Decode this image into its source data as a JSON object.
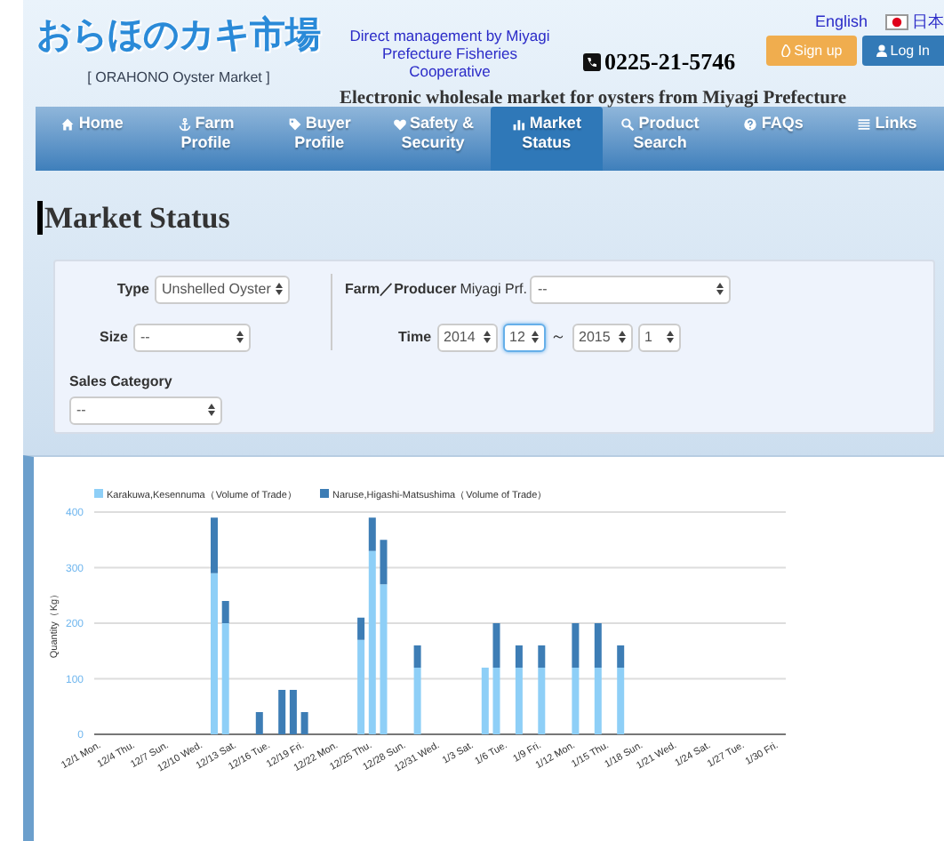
{
  "header": {
    "logo": "おらほのカキ市場",
    "logo_subtitle": "[ ORAHONO Oyster Market ]",
    "management": "Direct management by Miyagi Prefecture Fisheries Cooperative",
    "phone": "0225-21-5746",
    "tagline": "Electronic wholesale market for oysters from Miyagi Prefecture",
    "languages": [
      "English",
      "日本"
    ],
    "buttons": [
      {
        "label": "Sign up",
        "kind": "signup"
      },
      {
        "label": "Log In",
        "kind": "login"
      }
    ]
  },
  "nav": [
    {
      "label": "Home",
      "selected": false
    },
    {
      "label": "Farm Profile",
      "selected": false
    },
    {
      "label": "Buyer Profile",
      "selected": false
    },
    {
      "label": "Safety & Security",
      "selected": false
    },
    {
      "label": "Market Status",
      "selected": true
    },
    {
      "label": "Product Search",
      "selected": false
    },
    {
      "label": "FAQs",
      "selected": false
    },
    {
      "label": "Links",
      "selected": false
    }
  ],
  "page_title": "Market Status",
  "filters": {
    "type": {
      "label": "Type",
      "value": "Unshelled Oyster"
    },
    "size": {
      "label": "Size",
      "value": "--"
    },
    "sales_category": {
      "label": "Sales Category",
      "value": "--"
    },
    "farm": {
      "label": "Farm／Producer",
      "prefix": "Miyagi Prf.",
      "value": "--"
    },
    "time": {
      "label": "Time",
      "separator": "～",
      "selects": [
        {
          "value": "2014",
          "focused": false
        },
        {
          "value": "12",
          "focused": true
        },
        {
          "value": "2015",
          "focused": false
        },
        {
          "value": "1",
          "focused": false
        }
      ]
    }
  },
  "chart_data": {
    "type": "bar",
    "stacked": true,
    "ylabel": "Quantity（Kg）",
    "categories": [
      "12/1 Mon.",
      null,
      null,
      "12/4 Thu.",
      null,
      null,
      "12/7 Sun.",
      null,
      null,
      "12/10 Wed.",
      null,
      null,
      "12/13 Sat.",
      null,
      null,
      "12/16 Tue.",
      null,
      null,
      "12/19 Fri.",
      null,
      null,
      "12/22 Mon.",
      null,
      null,
      "12/25 Thu.",
      null,
      null,
      "12/28 Sun.",
      null,
      null,
      "12/31 Wed.",
      null,
      null,
      "1/3 Sat.",
      null,
      null,
      "1/6 Tue.",
      null,
      null,
      "1/9 Fri.",
      null,
      null,
      "1/12 Mon.",
      null,
      null,
      "1/15 Thu.",
      null,
      null,
      "1/18 Sun.",
      null,
      null,
      "1/21 Wed.",
      null,
      null,
      "1/24 Sat.",
      null,
      null,
      "1/27 Tue.",
      null,
      null,
      "1/30 Fri."
    ],
    "series": [
      {
        "name": "Karakuwa,Kesennuma（Volume of Trade）",
        "color": "#8ecff7",
        "values": [
          null,
          null,
          null,
          null,
          null,
          null,
          null,
          null,
          null,
          null,
          290,
          200,
          null,
          null,
          null,
          null,
          null,
          null,
          null,
          null,
          null,
          null,
          null,
          170,
          330,
          270,
          null,
          null,
          120,
          null,
          null,
          null,
          null,
          null,
          120,
          120,
          null,
          120,
          null,
          120,
          null,
          null,
          120,
          null,
          120,
          null,
          120,
          null,
          null,
          null,
          null,
          null,
          null,
          null,
          null,
          null,
          null,
          null,
          null,
          null,
          null
        ]
      },
      {
        "name": "Naruse,Higashi-Matsushima（Volume of Trade）",
        "color": "#3d7db5",
        "values": [
          null,
          null,
          null,
          null,
          null,
          null,
          null,
          null,
          null,
          null,
          100,
          40,
          null,
          null,
          40,
          null,
          80,
          80,
          40,
          null,
          null,
          null,
          null,
          40,
          60,
          80,
          null,
          null,
          40,
          null,
          null,
          null,
          null,
          null,
          null,
          80,
          null,
          40,
          null,
          40,
          null,
          null,
          80,
          null,
          80,
          null,
          40,
          null,
          null,
          null,
          null,
          null,
          null,
          null,
          null,
          null,
          null,
          null,
          null,
          null,
          null
        ]
      }
    ],
    "ylim": [
      0,
      400
    ],
    "yticks": [
      0,
      100,
      200,
      300,
      400
    ],
    "grid": true,
    "legend": true
  }
}
